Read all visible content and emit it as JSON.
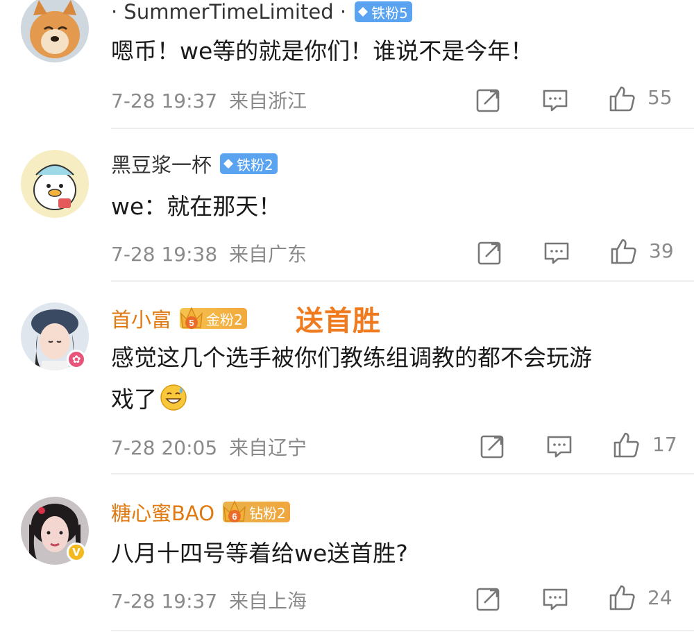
{
  "comments": [
    {
      "username": "· SummerTimeLimited ·",
      "badge": "铁粉5",
      "text": "嗯币！we等的就是你们！谁说不是今年！",
      "time": "7-28 19:37",
      "location": "来自浙江",
      "likes": "55"
    },
    {
      "username": "黑豆浆一杯",
      "badge": "铁粉2",
      "text": "we：就在那天！",
      "time": "7-28 19:38",
      "location": "来自广东",
      "likes": "39"
    },
    {
      "username": "首小富",
      "badge": "金粉2",
      "badge_level": "5",
      "overlay": "送首胜",
      "text_line1": "感觉这几个选手被你们教练组调教的都不会玩游",
      "text_line2": "戏了",
      "time": "7-28 20:05",
      "location": "来自辽宁",
      "likes": "17"
    },
    {
      "username": "糖心蜜BAO",
      "badge": "钻粉2",
      "badge_level": "6",
      "text": "八月十四号等着给we送首胜?",
      "time": "7-28 19:37",
      "location": "来自上海",
      "likes": "24"
    }
  ],
  "icons": {
    "repost": "repost-icon",
    "comment": "comment-icon",
    "like": "thumbs-up-icon"
  },
  "colors": {
    "gold_name": "#e07a10",
    "overlay": "#f07b1e",
    "iron_badge": "#5aa3f0",
    "meta_grey": "#8a8a8a"
  }
}
